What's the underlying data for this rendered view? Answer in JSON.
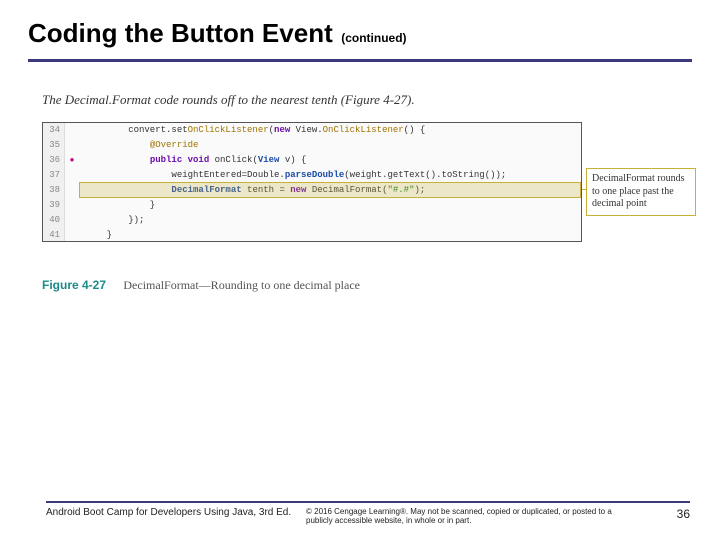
{
  "header": {
    "title": "Coding the Button Event",
    "continued": "(continued)"
  },
  "intro": "The Decimal.Format code rounds off to the nearest tenth (Figure 4-27).",
  "code": {
    "lines": [
      {
        "num": "34",
        "icon": "",
        "text_html": "        convert.set<span class='kw-gold'>OnClickListener</span>(<span class='kw-purple'>new</span> View.<span class='kw-gold'>OnClickListener</span>() {"
      },
      {
        "num": "35",
        "icon": "",
        "text_html": "            <span class='kw-gold'>@Override</span>"
      },
      {
        "num": "36",
        "icon": "●",
        "text_html": "            <span class='kw-purple'>public void</span> onClick(<span class='kw-blue'>View</span> v) {"
      },
      {
        "num": "37",
        "icon": "",
        "text_html": "                weightEntered=Double.<span class='kw-blue'>parseDouble</span>(weight.getText().toString());"
      },
      {
        "num": "38",
        "icon": "",
        "text_html": "                <span class='kw-blue'>DecimalFormat</span> tenth = <span class='kw-purple'>new</span> DecimalFormat(<span class='str-green'>\"#.#\"</span>);",
        "highlight": true
      },
      {
        "num": "39",
        "icon": "",
        "text_html": "            }"
      },
      {
        "num": "40",
        "icon": "",
        "text_html": "        });"
      },
      {
        "num": "41",
        "icon": "",
        "text_html": "    }"
      }
    ]
  },
  "callout": "DecimalFormat rounds to one place past the decimal point",
  "figure": {
    "label": "Figure 4-27",
    "caption": "DecimalFormat—Rounding to one decimal place"
  },
  "footer": {
    "book": "Android Boot Camp for Developers Using Java, 3rd Ed.",
    "copyright": "© 2016 Cengage Learning®. May not be scanned, copied or duplicated, or posted to a publicly accessible website, in whole or in part.",
    "page": "36"
  }
}
